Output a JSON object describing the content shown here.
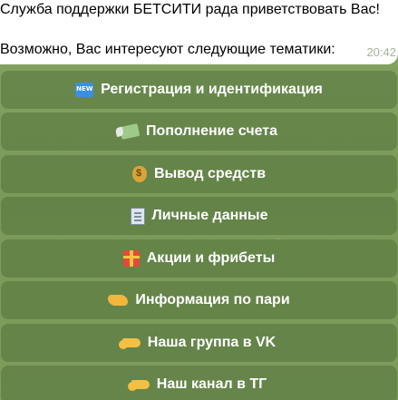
{
  "message": {
    "line1": "Служба поддержки БЕТСИТИ рада приветствовать Вас!",
    "line2": "Возможно, Вас интересуют следующие тематики:",
    "time": "20:42"
  },
  "keyboard": {
    "buttons": [
      {
        "icon": "new-icon",
        "label": "Регистрация и идентификация"
      },
      {
        "icon": "money-with-wings-icon",
        "label": "Пополнение счета"
      },
      {
        "icon": "money-bag-icon",
        "label": "Вывод средств"
      },
      {
        "icon": "document-icon",
        "label": "Личные данные"
      },
      {
        "icon": "gift-icon",
        "label": "Акции и фрибеты"
      },
      {
        "icon": "handshake-icon",
        "label": "Информация по пари"
      },
      {
        "icon": "pointing-hand-icon",
        "label": "Наша группа в VK"
      },
      {
        "icon": "pointing-hand-icon",
        "label": "Наш канал в ТГ"
      }
    ]
  },
  "colors": {
    "chat_background": "#7c9a5d",
    "bubble": "#ffffff",
    "button_fill": "rgba(64,94,44,0.38)",
    "button_text": "#ffffff",
    "time_text": "#a8b1a0"
  }
}
